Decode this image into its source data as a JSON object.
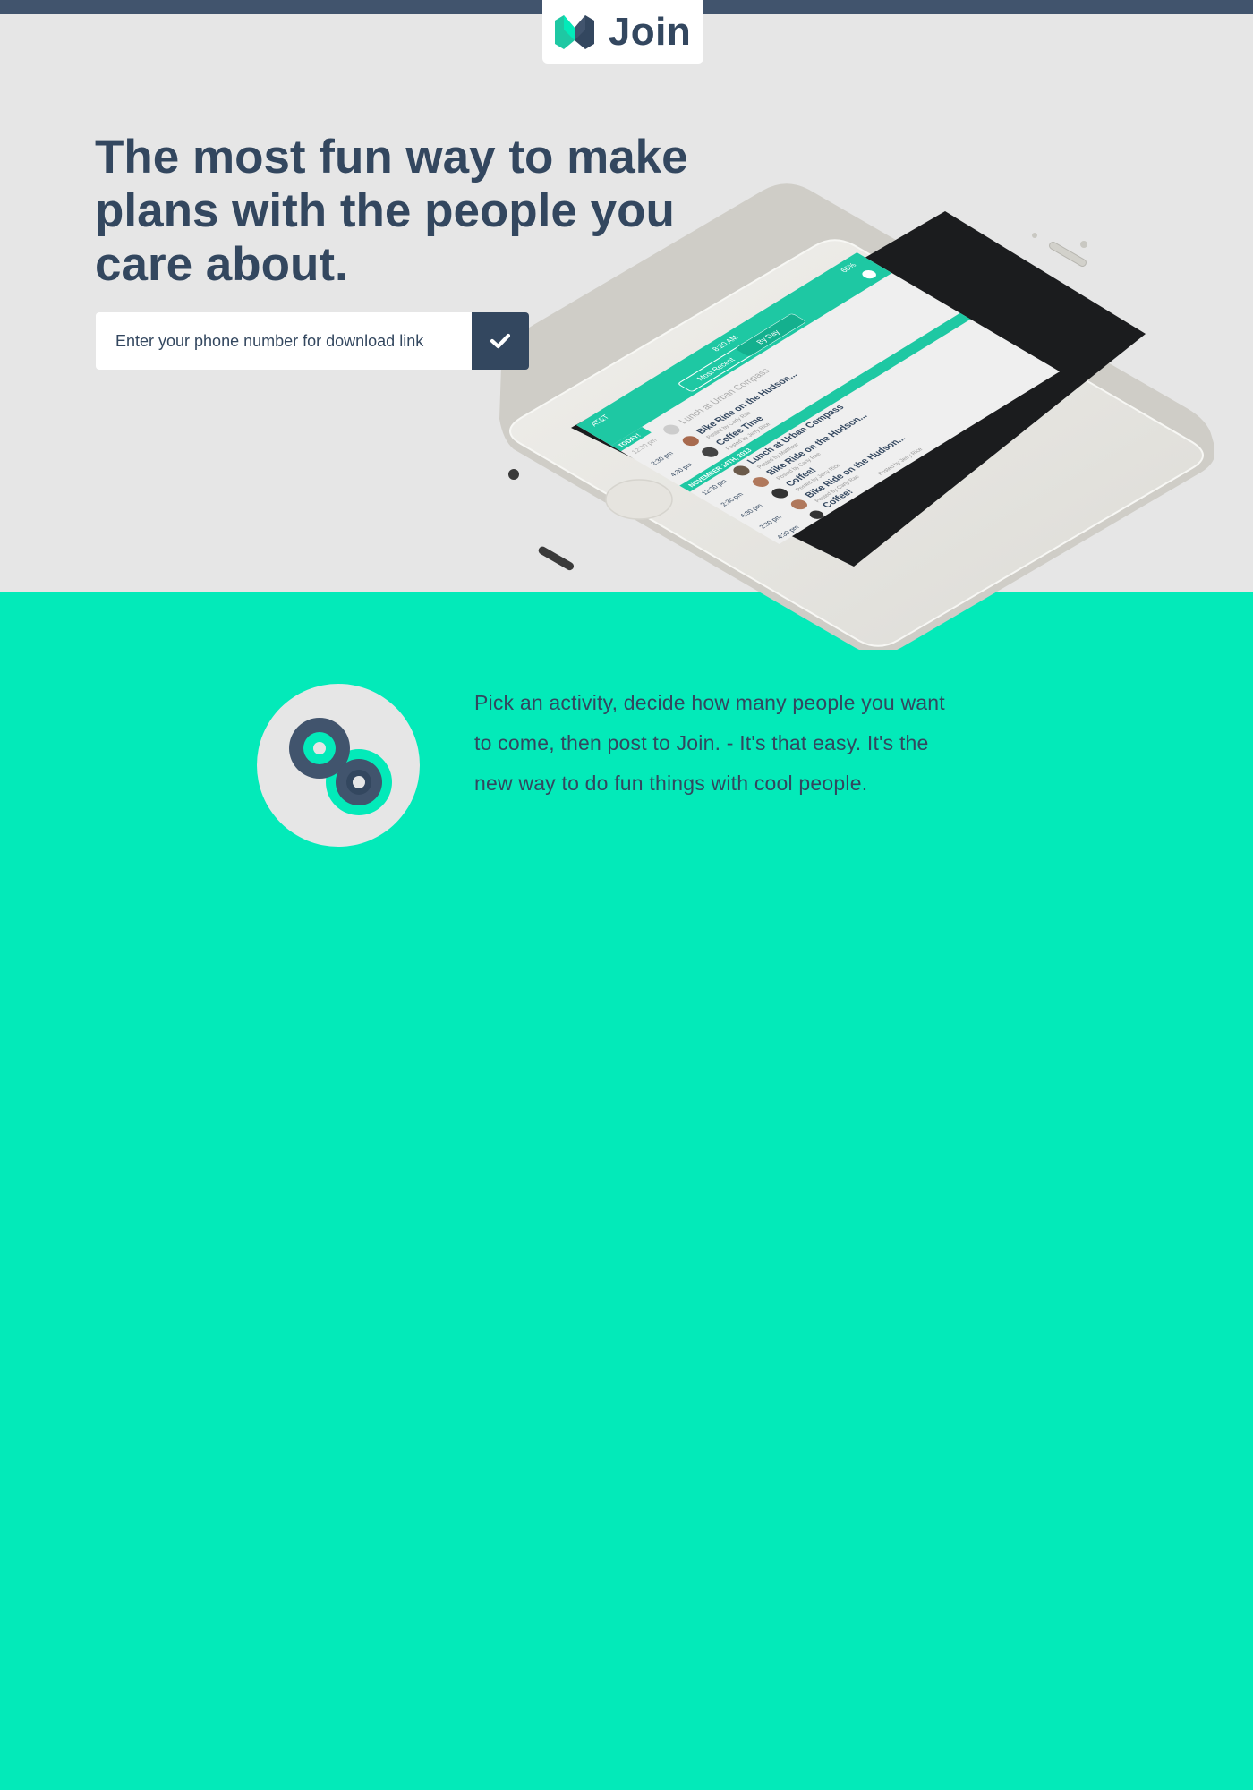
{
  "brand": {
    "name": "Join",
    "logo_icon": "join-logo-icon"
  },
  "hero": {
    "headline": "The most fun way to make plans with the people you care about.",
    "phone_input_placeholder": "Enter your phone number for download link",
    "submit_icon": "checkmark-icon"
  },
  "phone_screen": {
    "status": {
      "carrier": "AT&T",
      "time": "8:20 AM",
      "battery": "66%"
    },
    "tabs": [
      "Most Recent",
      "By Day"
    ],
    "sections": [
      {
        "label": "TODAY!",
        "items": [
          {
            "time": "12:30 pm",
            "title": "Lunch at Urban Compass",
            "poster": "Posted by Matthew",
            "faded": true
          },
          {
            "time": "2:30 pm",
            "title": "Bike Ride on the Hudson...",
            "poster": "Posted by Carly Rae"
          },
          {
            "time": "4:30 pm",
            "title": "Coffee Time",
            "poster": "Posted by Jerry Rice"
          }
        ]
      },
      {
        "label": "NOVEMBER 14TH, 2013",
        "items": [
          {
            "time": "12:30 pm",
            "title": "Lunch at Urban Compass",
            "poster": "Posted by Matthew"
          },
          {
            "time": "2:30 pm",
            "title": "Bike Ride on the Hudson...",
            "poster": "Posted by Carly Rae"
          },
          {
            "time": "4:30 pm",
            "title": "Coffee!",
            "poster": "Posted by Jerry Rice"
          },
          {
            "time": "2:30 pm",
            "title": "Bike Ride on the Hudson...",
            "poster": "Posted by Carly Rae"
          },
          {
            "time": "4:30 pm",
            "title": "Coffee!",
            "poster": "Posted by Jerry Rice"
          }
        ]
      }
    ]
  },
  "feature": {
    "icon": "infinity-loop-icon",
    "text": "Pick an activity, decide how many people you want to come, then post to Join. - It's that easy. It's the new way to do fun things with cool people."
  },
  "colors": {
    "navy": "#33475f",
    "teal": "#03eab9",
    "hero_bg": "#e6e6e6",
    "app_green": "#1ec8a3"
  }
}
